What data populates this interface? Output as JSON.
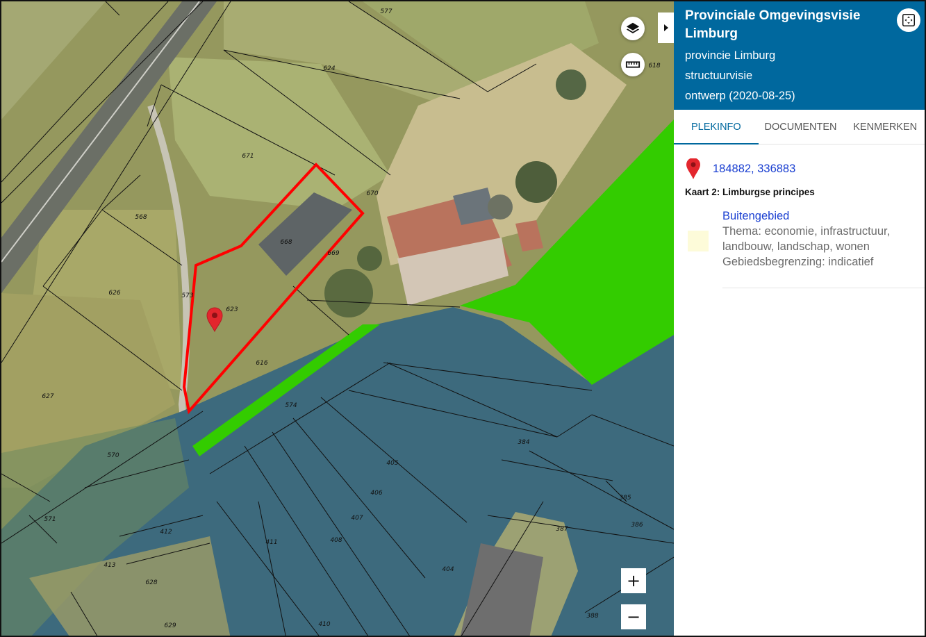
{
  "map": {
    "parcels": [
      {
        "id": "577"
      },
      {
        "id": "624"
      },
      {
        "id": "618"
      },
      {
        "id": "671"
      },
      {
        "id": "670"
      },
      {
        "id": "568"
      },
      {
        "id": "668"
      },
      {
        "id": "669"
      },
      {
        "id": "626"
      },
      {
        "id": "573"
      },
      {
        "id": "623"
      },
      {
        "id": "616"
      },
      {
        "id": "627"
      },
      {
        "id": "574"
      },
      {
        "id": "570"
      },
      {
        "id": "384"
      },
      {
        "id": "405"
      },
      {
        "id": "406"
      },
      {
        "id": "407"
      },
      {
        "id": "408"
      },
      {
        "id": "411"
      },
      {
        "id": "571"
      },
      {
        "id": "412"
      },
      {
        "id": "413"
      },
      {
        "id": "628"
      },
      {
        "id": "629"
      },
      {
        "id": "410"
      },
      {
        "id": "404"
      },
      {
        "id": "387"
      },
      {
        "id": "385"
      },
      {
        "id": "386"
      },
      {
        "id": "388"
      }
    ],
    "controls": {
      "zoom_in": "+",
      "zoom_out": "−"
    },
    "colors": {
      "selection_outline": "#ff0000",
      "green_zone": "#33cc00",
      "blue_zone": "#3d6a7d",
      "pin": "#e3262d"
    }
  },
  "panel": {
    "title": "Provinciale Omgevingsvisie Limburg",
    "subtitle_lines": [
      "provincie Limburg",
      "structuurvisie",
      "ontwerp (2020-08-25)"
    ],
    "header_color": "#00689e",
    "tabs": [
      {
        "label": "PLEKINFO",
        "active": true
      },
      {
        "label": "DOCUMENTEN",
        "active": false
      },
      {
        "label": "KENMERKEN",
        "active": false
      }
    ],
    "location": {
      "coordinates": "184882, 336883",
      "icon": "location-pin-icon"
    },
    "map_name": "Kaart 2: Limburgse principes",
    "legend": {
      "title": "Buitengebied",
      "swatch_color": "#fdfbd9",
      "lines": [
        "Thema: economie, infrastructuur,",
        "landbouw, landschap, wonen",
        "Gebiedsbegrenzing: indicatief"
      ]
    }
  }
}
